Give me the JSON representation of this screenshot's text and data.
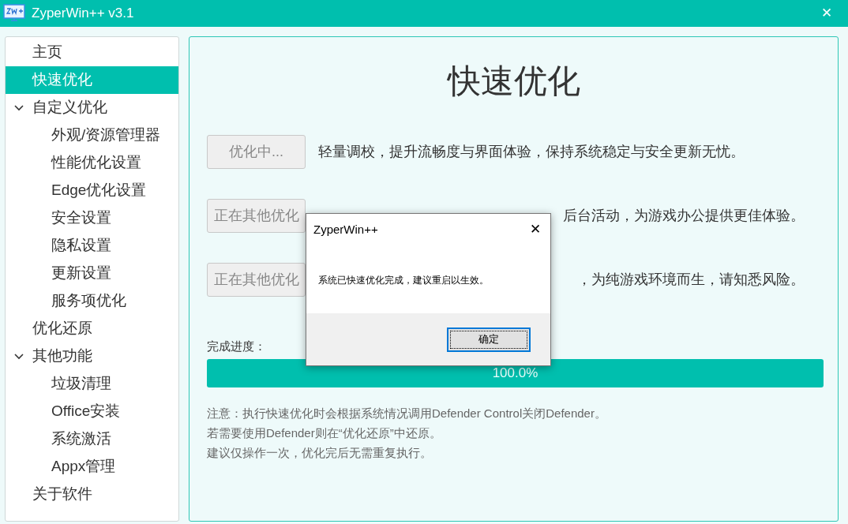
{
  "window": {
    "title": "ZyperWin++ v3.1",
    "close": "✕"
  },
  "sidebar": {
    "items": [
      {
        "label": "主页",
        "selected": false
      },
      {
        "label": "快速优化",
        "selected": true
      },
      {
        "label": "自定义优化",
        "selected": false,
        "expanded": true,
        "children": [
          {
            "label": "外观/资源管理器",
            "selected": false
          },
          {
            "label": "性能优化设置",
            "selected": false
          },
          {
            "label": "Edge优化设置",
            "selected": false
          },
          {
            "label": "安全设置",
            "selected": false
          },
          {
            "label": "隐私设置",
            "selected": false
          },
          {
            "label": "更新设置",
            "selected": false
          },
          {
            "label": "服务项优化",
            "selected": false
          }
        ]
      },
      {
        "label": "优化还原",
        "selected": false
      },
      {
        "label": "其他功能",
        "selected": false,
        "expanded": true,
        "children": [
          {
            "label": "垃圾清理",
            "selected": false
          },
          {
            "label": "Office安装",
            "selected": false
          },
          {
            "label": "系统激活",
            "selected": false
          },
          {
            "label": "Appx管理",
            "selected": false
          }
        ]
      },
      {
        "label": "关于软件",
        "selected": false
      }
    ]
  },
  "main": {
    "heading": "快速优化",
    "modes": [
      {
        "button": "优化中...",
        "disabled": true,
        "description": "轻量调校，提升流畅度与界面体验，保持系统稳定与安全更新无忧。"
      },
      {
        "button": "正在其他优化",
        "disabled": true,
        "description": "后台活动，为游戏办公提供更佳体验。"
      },
      {
        "button": "正在其他优化",
        "disabled": true,
        "description": "，为纯游戏环境而生，请知悉风险。"
      }
    ],
    "progress_label": "完成进度：",
    "progress": {
      "level": 1.0,
      "reading": "100.0%"
    },
    "notes": [
      "注意：执行快速优化时会根据系统情况调用Defender Control关闭Defender。",
      "若需要使用Defender则在“优化还原”中还原。",
      "建议仅操作一次，优化完后无需重复执行。"
    ]
  },
  "dialog": {
    "title": "ZyperWin++",
    "close": "✕",
    "message": "系统已快速优化完成，建议重启以生效。",
    "button": "确定"
  }
}
